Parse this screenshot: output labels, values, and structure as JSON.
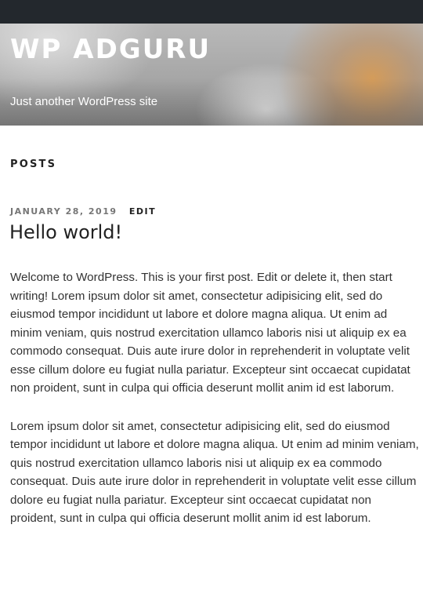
{
  "site": {
    "title": "WP ADGURU",
    "description": "Just another WordPress site"
  },
  "posts_heading": "POSTS",
  "post": {
    "date": "JANUARY 28, 2019",
    "edit_label": "EDIT",
    "title": "Hello world!",
    "paragraphs": [
      "Welcome to WordPress. This is your first post. Edit or delete it, then start writing! Lorem ipsum dolor sit amet, consectetur adipisicing elit, sed do eiusmod tempor incididunt ut labore et dolore magna aliqua. Ut enim ad minim veniam, quis nostrud exercitation ullamco laboris nisi ut aliquip ex ea commodo consequat. Duis aute irure dolor in reprehenderit in voluptate velit esse cillum dolore eu fugiat nulla pariatur. Excepteur sint occaecat cupidatat non proident, sunt in culpa qui officia deserunt mollit anim id est laborum.",
      "Lorem ipsum dolor sit amet, consectetur adipisicing elit, sed do eiusmod tempor incididunt ut labore et dolore magna aliqua. Ut enim ad minim veniam, quis nostrud exercitation ullamco laboris nisi ut aliquip ex ea commodo consequat. Duis aute irure dolor in reprehenderit in voluptate velit esse cillum dolore eu fugiat nulla pariatur. Excepteur sint occaecat cupidatat non proident, sunt in culpa qui officia deserunt mollit anim id est laborum."
    ]
  },
  "colors": {
    "admin_bar": "#23282d",
    "heading_text": "#222222",
    "meta_text": "#767676",
    "body_text": "#333333"
  }
}
